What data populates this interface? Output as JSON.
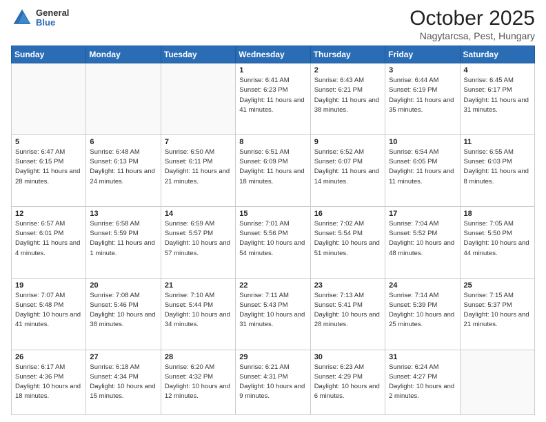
{
  "header": {
    "logo_general": "General",
    "logo_blue": "Blue",
    "month": "October 2025",
    "location": "Nagytarcsa, Pest, Hungary"
  },
  "days_of_week": [
    "Sunday",
    "Monday",
    "Tuesday",
    "Wednesday",
    "Thursday",
    "Friday",
    "Saturday"
  ],
  "weeks": [
    [
      {
        "day": "",
        "info": ""
      },
      {
        "day": "",
        "info": ""
      },
      {
        "day": "",
        "info": ""
      },
      {
        "day": "1",
        "info": "Sunrise: 6:41 AM\nSunset: 6:23 PM\nDaylight: 11 hours and 41 minutes."
      },
      {
        "day": "2",
        "info": "Sunrise: 6:43 AM\nSunset: 6:21 PM\nDaylight: 11 hours and 38 minutes."
      },
      {
        "day": "3",
        "info": "Sunrise: 6:44 AM\nSunset: 6:19 PM\nDaylight: 11 hours and 35 minutes."
      },
      {
        "day": "4",
        "info": "Sunrise: 6:45 AM\nSunset: 6:17 PM\nDaylight: 11 hours and 31 minutes."
      }
    ],
    [
      {
        "day": "5",
        "info": "Sunrise: 6:47 AM\nSunset: 6:15 PM\nDaylight: 11 hours and 28 minutes."
      },
      {
        "day": "6",
        "info": "Sunrise: 6:48 AM\nSunset: 6:13 PM\nDaylight: 11 hours and 24 minutes."
      },
      {
        "day": "7",
        "info": "Sunrise: 6:50 AM\nSunset: 6:11 PM\nDaylight: 11 hours and 21 minutes."
      },
      {
        "day": "8",
        "info": "Sunrise: 6:51 AM\nSunset: 6:09 PM\nDaylight: 11 hours and 18 minutes."
      },
      {
        "day": "9",
        "info": "Sunrise: 6:52 AM\nSunset: 6:07 PM\nDaylight: 11 hours and 14 minutes."
      },
      {
        "day": "10",
        "info": "Sunrise: 6:54 AM\nSunset: 6:05 PM\nDaylight: 11 hours and 11 minutes."
      },
      {
        "day": "11",
        "info": "Sunrise: 6:55 AM\nSunset: 6:03 PM\nDaylight: 11 hours and 8 minutes."
      }
    ],
    [
      {
        "day": "12",
        "info": "Sunrise: 6:57 AM\nSunset: 6:01 PM\nDaylight: 11 hours and 4 minutes."
      },
      {
        "day": "13",
        "info": "Sunrise: 6:58 AM\nSunset: 5:59 PM\nDaylight: 11 hours and 1 minute."
      },
      {
        "day": "14",
        "info": "Sunrise: 6:59 AM\nSunset: 5:57 PM\nDaylight: 10 hours and 57 minutes."
      },
      {
        "day": "15",
        "info": "Sunrise: 7:01 AM\nSunset: 5:56 PM\nDaylight: 10 hours and 54 minutes."
      },
      {
        "day": "16",
        "info": "Sunrise: 7:02 AM\nSunset: 5:54 PM\nDaylight: 10 hours and 51 minutes."
      },
      {
        "day": "17",
        "info": "Sunrise: 7:04 AM\nSunset: 5:52 PM\nDaylight: 10 hours and 48 minutes."
      },
      {
        "day": "18",
        "info": "Sunrise: 7:05 AM\nSunset: 5:50 PM\nDaylight: 10 hours and 44 minutes."
      }
    ],
    [
      {
        "day": "19",
        "info": "Sunrise: 7:07 AM\nSunset: 5:48 PM\nDaylight: 10 hours and 41 minutes."
      },
      {
        "day": "20",
        "info": "Sunrise: 7:08 AM\nSunset: 5:46 PM\nDaylight: 10 hours and 38 minutes."
      },
      {
        "day": "21",
        "info": "Sunrise: 7:10 AM\nSunset: 5:44 PM\nDaylight: 10 hours and 34 minutes."
      },
      {
        "day": "22",
        "info": "Sunrise: 7:11 AM\nSunset: 5:43 PM\nDaylight: 10 hours and 31 minutes."
      },
      {
        "day": "23",
        "info": "Sunrise: 7:13 AM\nSunset: 5:41 PM\nDaylight: 10 hours and 28 minutes."
      },
      {
        "day": "24",
        "info": "Sunrise: 7:14 AM\nSunset: 5:39 PM\nDaylight: 10 hours and 25 minutes."
      },
      {
        "day": "25",
        "info": "Sunrise: 7:15 AM\nSunset: 5:37 PM\nDaylight: 10 hours and 21 minutes."
      }
    ],
    [
      {
        "day": "26",
        "info": "Sunrise: 6:17 AM\nSunset: 4:36 PM\nDaylight: 10 hours and 18 minutes."
      },
      {
        "day": "27",
        "info": "Sunrise: 6:18 AM\nSunset: 4:34 PM\nDaylight: 10 hours and 15 minutes."
      },
      {
        "day": "28",
        "info": "Sunrise: 6:20 AM\nSunset: 4:32 PM\nDaylight: 10 hours and 12 minutes."
      },
      {
        "day": "29",
        "info": "Sunrise: 6:21 AM\nSunset: 4:31 PM\nDaylight: 10 hours and 9 minutes."
      },
      {
        "day": "30",
        "info": "Sunrise: 6:23 AM\nSunset: 4:29 PM\nDaylight: 10 hours and 6 minutes."
      },
      {
        "day": "31",
        "info": "Sunrise: 6:24 AM\nSunset: 4:27 PM\nDaylight: 10 hours and 2 minutes."
      },
      {
        "day": "",
        "info": ""
      }
    ]
  ]
}
